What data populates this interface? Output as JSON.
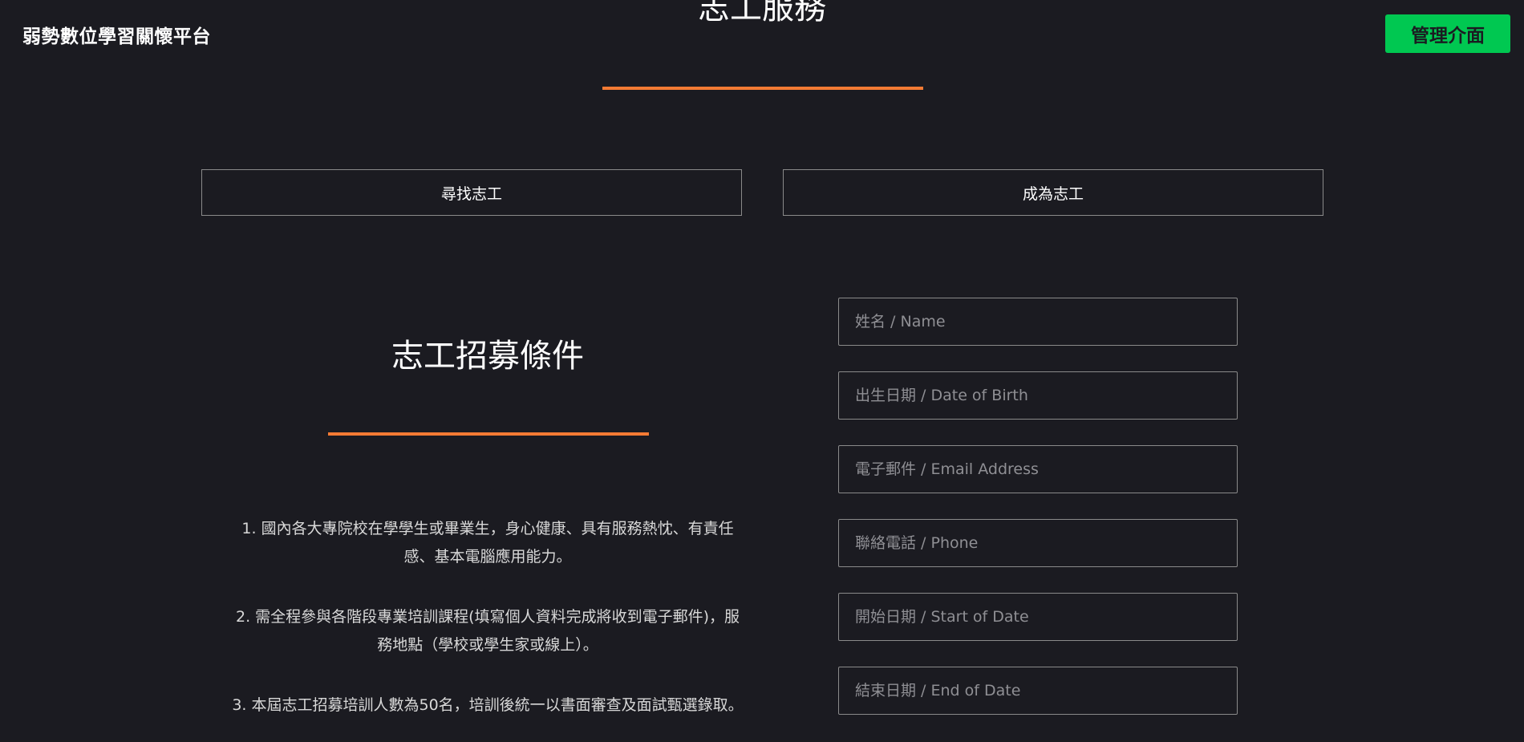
{
  "header": {
    "brand": "弱勢數位學習關懷平台",
    "admin_label": "管理介面"
  },
  "section": {
    "title": "志工服務"
  },
  "tabs": [
    {
      "label": "尋找志工"
    },
    {
      "label": "成為志工"
    }
  ],
  "recruitment": {
    "title": "志工招募條件",
    "items": [
      "1. 國內各大專院校在學學生或畢業生，身心健康、具有服務熱忱、有責任感、基本電腦應用能力。",
      "2. 需全程參與各階段專業培訓課程(填寫個人資料完成將收到電子郵件)，服務地點（學校或學生家或線上）。",
      "3. 本屆志工招募培訓人數為50名，培訓後統一以書面審查及面試甄選錄取。"
    ]
  },
  "form": {
    "name_placeholder": "姓名 / Name",
    "dob_placeholder": "出生日期 / Date of Birth",
    "email_placeholder": "電子郵件 / Email Address",
    "phone_placeholder": "聯絡電話 / Phone",
    "start_placeholder": "開始日期 / Start of Date",
    "end_placeholder": "結束日期 / End of Date"
  },
  "colors": {
    "background": "#1b1b21",
    "accent_underline": "#f47b34",
    "admin_button": "#00c851"
  }
}
